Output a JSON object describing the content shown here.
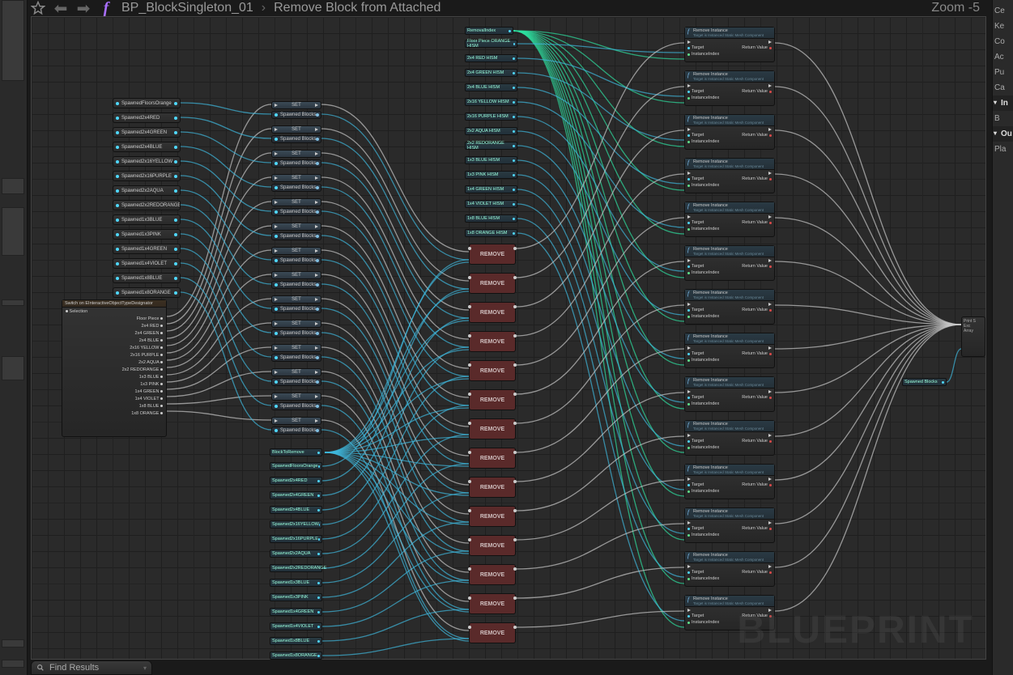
{
  "header": {
    "blueprint_name": "BP_BlockSingleton_01",
    "function_name": "Remove Block from Attached",
    "breadcrumb_sep": "›",
    "zoom_label": "Zoom -5"
  },
  "footer": {
    "find_results": "Find Results"
  },
  "watermark": "BLUEPRINT",
  "right_panel": {
    "items": [
      "Ce",
      "Ke",
      "Co",
      "Ac",
      "Pu",
      "Ca"
    ],
    "section_inputs": "In",
    "input_item": "B",
    "section_outputs": "Ou",
    "output_item": "Pla"
  },
  "switch_node": {
    "title": "Switch on EInteractiveObjectTypeDesignator",
    "input_label": "Selection",
    "outputs": [
      "Floor Piece",
      "2x4 RED",
      "2x4 GREEN",
      "2x4 BLUE",
      "2x16 YELLOW",
      "2x16 PURPLE",
      "2x2 AQUA",
      "2x2 REDORANGE",
      "1x3 BLUE",
      "1x3 PINK",
      "1x4 GREEN",
      "1x4 VIOLET",
      "1x8 BLUE",
      "1x8 ORANGE"
    ]
  },
  "spawned_vars": [
    "SpawnedFloorsOrange",
    "Spawned2x4RED",
    "Spawned2x4GREEN",
    "Spawned2x4BLUE",
    "Spawned2x16YELLOW",
    "Spawned2x16PURPLE",
    "Spawned2x2AQUA",
    "Spawned2x2REDORANGE",
    "Spawned1x3BLUE",
    "Spawned1x3PINK",
    "Spawned1x4GREEN",
    "Spawned1x4VIOLET",
    "Spawned1x8BLUE",
    "Spawned1x8ORANGE"
  ],
  "set_label": "SET",
  "set_pin_label": "Spawned Blocks",
  "remove_label": "REMOVE",
  "removal_index_label": "RemovalIndex",
  "hism_nodes": [
    "Floor Piece ORANGE HISM",
    "2x4 RED HISM",
    "2x4 GREEN HISM",
    "2x4 BLUE HISM",
    "2x16 YELLOW HISM",
    "2x16 PURPLE HISM",
    "2x2 AQUA HISM",
    "2x2 REDORANGE HISM",
    "1x3 BLUE HISM",
    "1x3 PINK HISM",
    "1x4 GREEN HISM",
    "1x4 VIOLET HISM",
    "1x8 BLUE HISM",
    "1x8 ORANGE HISM"
  ],
  "block_to_remove": "BlockToRemove",
  "spawned_blocks_vars": [
    "SpawnedFloorsOrange",
    "Spawned2x4RED",
    "Spawned2x4GREEN",
    "Spawned2x4BLUE",
    "Spawned2x16YELLOW",
    "Spawned2x16PURPLE",
    "Spawned2x2AQUA",
    "Spawned2x2REDORANGE",
    "Spawned1x3BLUE",
    "Spawned1x3PINK",
    "Spawned1x4GREEN",
    "Spawned1x4VIOLET",
    "Spawned1x8BLUE",
    "Spawned1x8ORANGE"
  ],
  "remove_instance": {
    "title": "Remove Instance",
    "subtitle": "Target is Instanced Static Mesh Component",
    "pin_target": "Target",
    "pin_index": "InstanceIndex",
    "pin_return": "Return Value"
  },
  "endcap": {
    "l1": "Print S",
    "l2": "Exc",
    "l3": "Array"
  },
  "endvar": "Spawned Blocks"
}
